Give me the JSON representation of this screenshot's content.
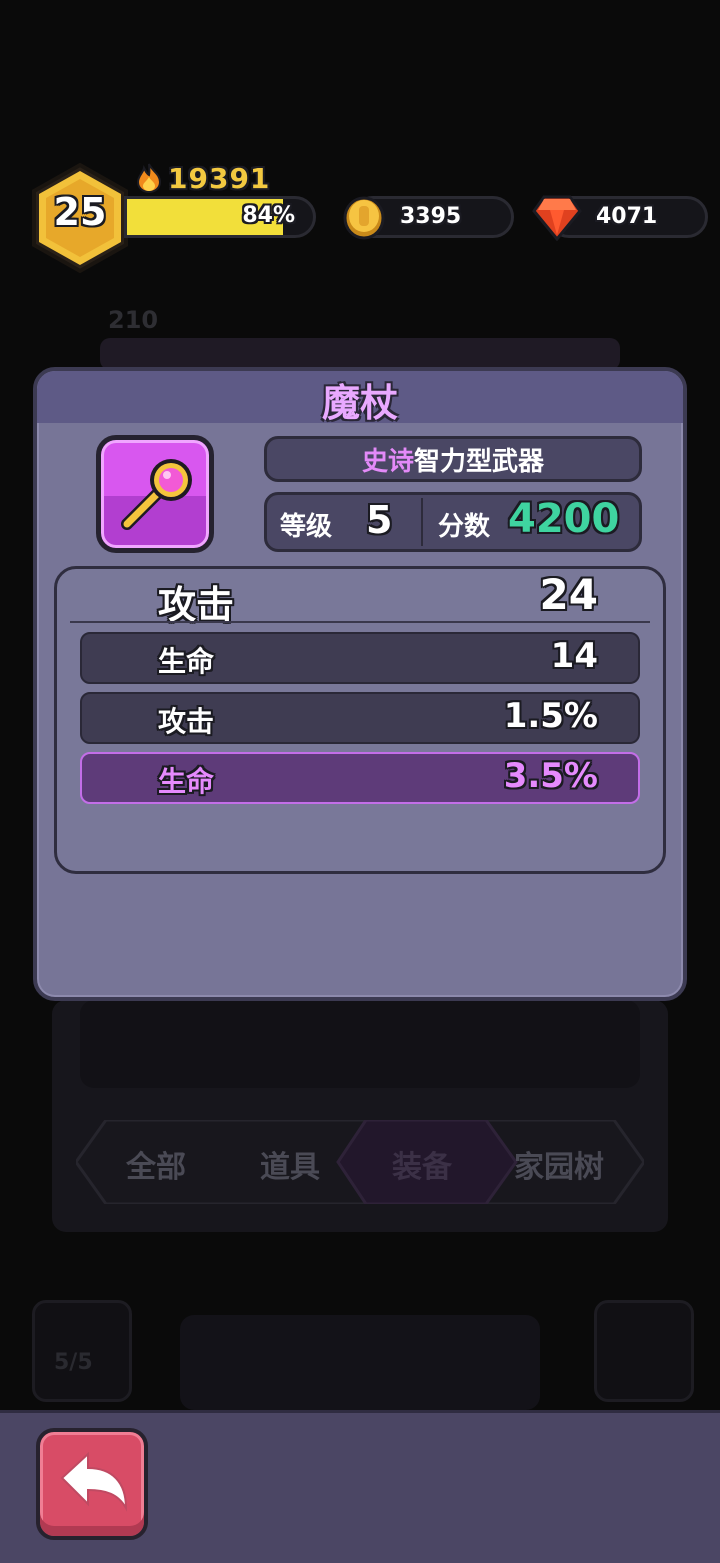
{
  "hud": {
    "level": "25",
    "power": "19391",
    "xp_percent_label": "84%",
    "xp_fraction": 0.84,
    "gold": "3395",
    "gems": "4071",
    "icons": {
      "power": "flame-icon",
      "gold": "gold-coin-icon",
      "gems": "red-gem-icon"
    }
  },
  "background": {
    "tabs": [
      "全部",
      "道具",
      "装备",
      "家园树"
    ],
    "active_tab": "装备",
    "counter": "5/5",
    "stat": "210"
  },
  "dialog": {
    "title": "魔杖",
    "item_icon": "magic-wand-icon",
    "rarity": "史诗",
    "type": "智力型武器",
    "level_label": "等级",
    "level_value": "5",
    "score_label": "分数",
    "score_value": "4200",
    "main_stat": {
      "label": "攻击",
      "value": "24"
    },
    "sub_stats": [
      {
        "label": "生命",
        "value": "14",
        "rarity": "normal"
      },
      {
        "label": "攻击",
        "value": "1.5%",
        "rarity": "normal"
      },
      {
        "label": "生命",
        "value": "3.5%",
        "rarity": "epic"
      }
    ]
  },
  "bottom": {
    "back_icon": "back-arrow-icon"
  },
  "colors": {
    "dialog_bg": "#777597",
    "title": "#e9a9ff",
    "epic": "#e58afd",
    "score": "#3fd4a0",
    "xp_fill": "#f2df3a",
    "back_button": "#d84c66"
  }
}
